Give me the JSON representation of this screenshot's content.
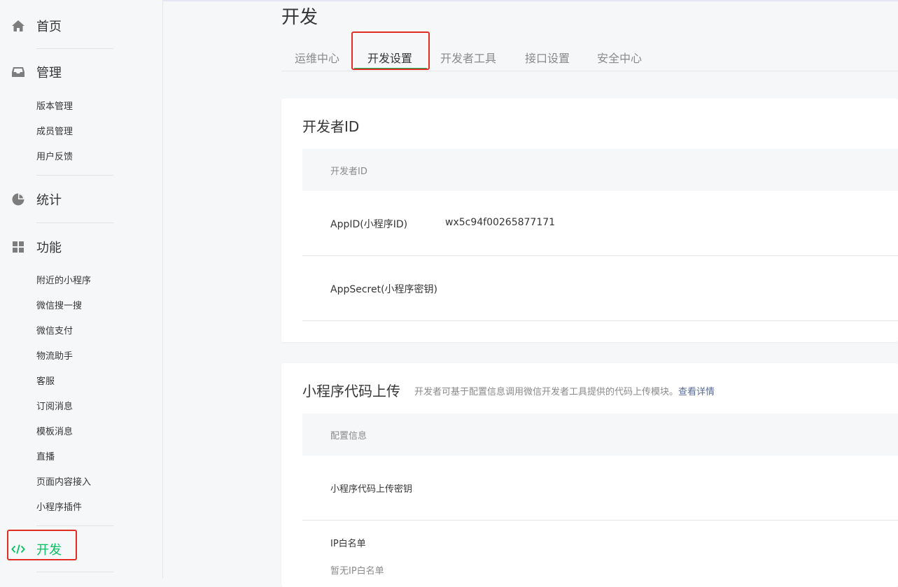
{
  "sidebar": {
    "home": "首页",
    "manage": {
      "label": "管理",
      "items": [
        "版本管理",
        "成员管理",
        "用户反馈"
      ]
    },
    "stats": "统计",
    "features": {
      "label": "功能",
      "items": [
        "附近的小程序",
        "微信搜一搜",
        "微信支付",
        "物流助手",
        "客服",
        "订阅消息",
        "模板消息",
        "直播",
        "页面内容接入",
        "小程序插件"
      ]
    },
    "develop": "开发"
  },
  "icons": {
    "home": "home-icon",
    "manage": "inbox-icon",
    "stats": "pie-chart-icon",
    "features": "grid-icon",
    "develop": "code-icon"
  },
  "colors": {
    "accent": "#07c160",
    "highlight": "#e02e24",
    "link": "#576b95"
  },
  "page": {
    "title": "开发",
    "tabs": [
      "运维中心",
      "开发设置",
      "开发者工具",
      "接口设置",
      "安全中心"
    ],
    "active_tab": "开发设置"
  },
  "developer_id": {
    "title": "开发者ID",
    "header": "开发者ID",
    "appid_label": "AppID(小程序ID)",
    "appid_value": "wx5c94f00265877171",
    "secret_label": "AppSecret(小程序密钥)"
  },
  "code_upload": {
    "title": "小程序代码上传",
    "desc": "开发者可基于配置信息调用微信开发者工具提供的代码上传模块。",
    "desc_link": "查看详情",
    "header": "配置信息",
    "key_label": "小程序代码上传密钥",
    "ip_label": "IP白名单",
    "ip_empty": "暂无IP白名单"
  }
}
